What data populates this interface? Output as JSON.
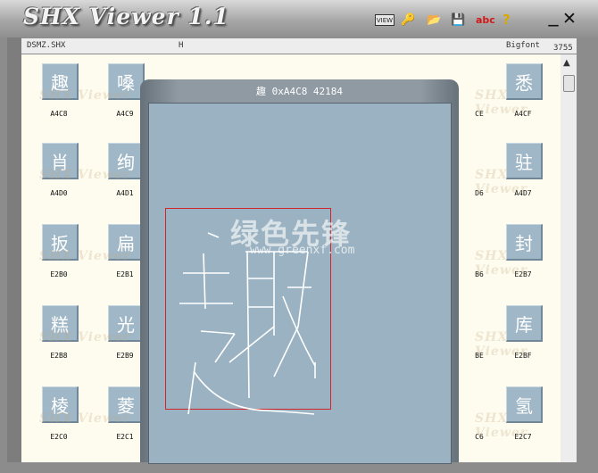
{
  "app": {
    "title": "SHX Viewer 1.1",
    "toolbar": [
      {
        "name": "view-icon",
        "glyph": "VIEW",
        "color": "#222222",
        "bg": "#e8e8e8"
      },
      {
        "name": "key-icon",
        "glyph": "🔑",
        "color": "#c59a00",
        "bg": ""
      },
      {
        "name": "open-folder-icon",
        "glyph": "📂",
        "color": "#d6a000",
        "bg": ""
      },
      {
        "name": "save-icon",
        "glyph": "💾",
        "color": "#111111",
        "bg": ""
      },
      {
        "name": "abc-font-icon",
        "glyph": "abc",
        "color": "#d11a1a",
        "bg": ""
      },
      {
        "name": "help-icon",
        "glyph": "?",
        "color": "#d9a800",
        "bg": ""
      }
    ],
    "minimize": "_",
    "close": "✕"
  },
  "header": {
    "file": "DSMZ.SHX",
    "h_label": "H",
    "font_type": "Bigfont",
    "count": "3755"
  },
  "grid": {
    "rows": [
      {
        "chars": [
          "趣",
          "嗓",
          "",
          "",
          "",
          "",
          "",
          "",
          "",
          "悉"
        ],
        "codes": [
          "A4C8",
          "A4C9",
          "",
          "",
          "",
          "",
          "",
          "",
          "CE",
          "A4CF"
        ]
      },
      {
        "chars": [
          "肖",
          "绚",
          "",
          "",
          "",
          "",
          "",
          "",
          "",
          "驻"
        ],
        "codes": [
          "A4D0",
          "A4D1",
          "",
          "",
          "",
          "",
          "",
          "",
          "D6",
          "A4D7"
        ]
      },
      {
        "chars": [
          "扳",
          "扁",
          "",
          "",
          "",
          "",
          "",
          "",
          "",
          "封"
        ],
        "codes": [
          "E2B0",
          "E2B1",
          "",
          "",
          "",
          "",
          "",
          "",
          "B6",
          "E2B7"
        ]
      },
      {
        "chars": [
          "糕",
          "光",
          "",
          "",
          "",
          "",
          "",
          "",
          "",
          "库"
        ],
        "codes": [
          "E2B8",
          "E2B9",
          "",
          "",
          "",
          "",
          "",
          "",
          "BE",
          "E2BF"
        ]
      },
      {
        "chars": [
          "棱",
          "菱",
          "",
          "",
          "",
          "",
          "",
          "",
          "",
          "氢"
        ],
        "codes": [
          "E2C0",
          "E2C1",
          "",
          "",
          "",
          "",
          "",
          "",
          "C6",
          "E2C7"
        ]
      }
    ],
    "watermark": "SHX Viewer"
  },
  "preview": {
    "title": "趣 0xA4C8 42184",
    "brand": "绿色先锋",
    "brand_url": "www.greenxf.com"
  }
}
